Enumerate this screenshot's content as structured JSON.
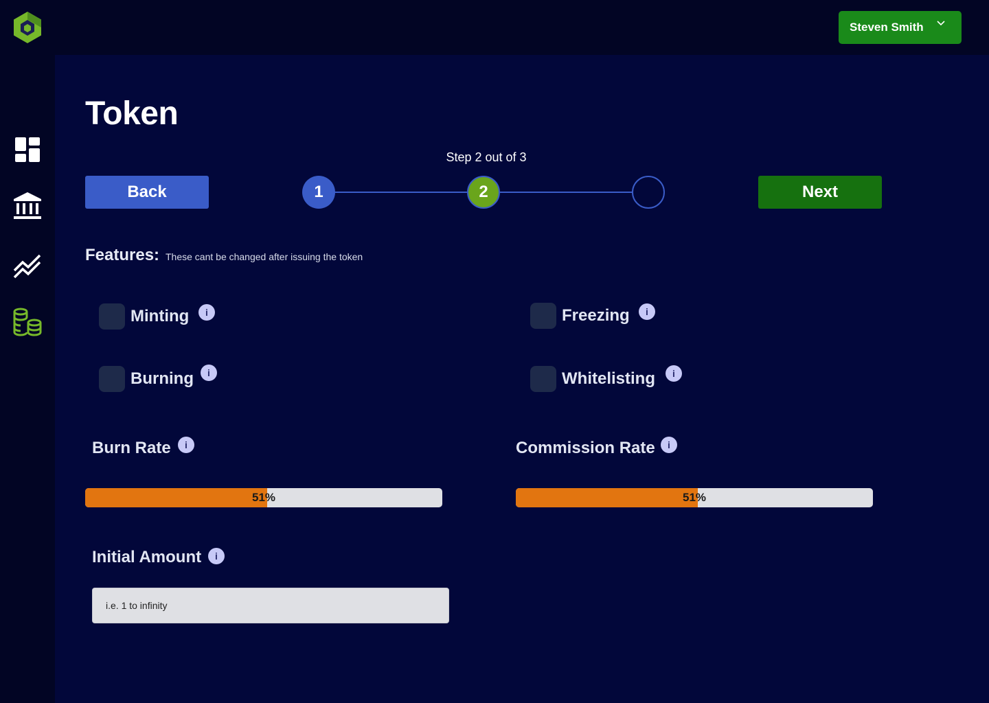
{
  "user": {
    "name": "Steven Smith",
    "menu_icon": "chevron-down-icon"
  },
  "sidebar": {
    "items": [
      {
        "icon": "dashboard-icon",
        "active": false
      },
      {
        "icon": "bank-icon",
        "active": false
      },
      {
        "icon": "trend-chart-icon",
        "active": false
      },
      {
        "icon": "coins-stack-icon",
        "active": true
      }
    ]
  },
  "page": {
    "title": "Token"
  },
  "stepper": {
    "status": "Step 2 out of 3",
    "current": 2,
    "total": 3,
    "steps": [
      "1",
      "2",
      ""
    ]
  },
  "buttons": {
    "back": "Back",
    "next": "Next"
  },
  "features": {
    "title": "Features:",
    "note": "These cant be changed after issuing the token",
    "items": [
      {
        "label": "Minting",
        "checked": false
      },
      {
        "label": "Freezing",
        "checked": false
      },
      {
        "label": "Burning",
        "checked": false
      },
      {
        "label": "Whitelisting",
        "checked": false
      }
    ]
  },
  "info_glyph": "i",
  "burn_rate": {
    "label": "Burn Rate",
    "value": 51,
    "display": "51%"
  },
  "commission_rate": {
    "label": "Commission Rate",
    "value": 51,
    "display": "51%"
  },
  "initial_amount": {
    "label": "Initial Amount",
    "value": "",
    "placeholder": "i.e. 1 to infinity"
  },
  "colors": {
    "background": "#02073a",
    "accent_blue": "#3a5cc8",
    "accent_green": "#16710f",
    "slider_fill": "#e27510"
  }
}
